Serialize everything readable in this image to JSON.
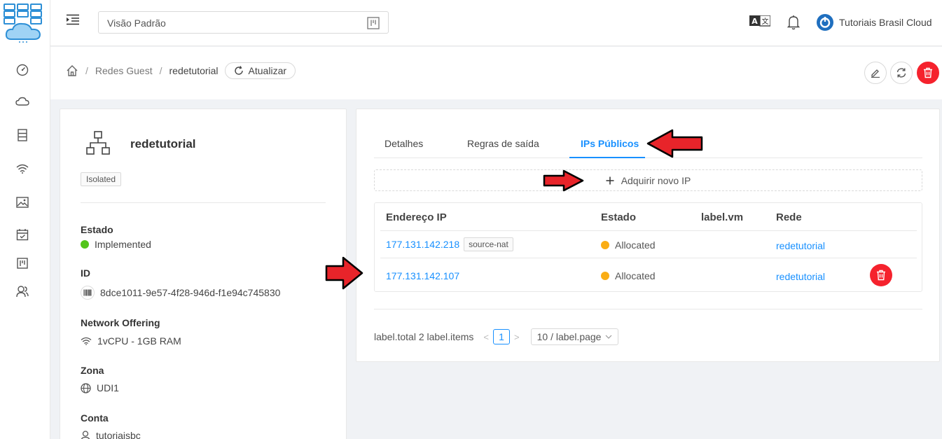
{
  "header": {
    "project_selector": "Visão Padrão",
    "user_name": "Tutoriais Brasil Cloud"
  },
  "breadcrumb": {
    "items": [
      "Redes Guest",
      "redetutorial"
    ],
    "refresh_label": "Atualizar"
  },
  "network": {
    "name": "redetutorial",
    "type_tag": "Isolated",
    "fields": [
      {
        "label": "Estado",
        "value": "Implemented",
        "icon": "green-status-dot"
      },
      {
        "label": "ID",
        "value": "8dce1011-9e57-4f28-946d-f1e94c745830",
        "icon": "barcode-icon"
      },
      {
        "label": "Network Offering",
        "value": "1vCPU - 1GB RAM",
        "icon": "wifi-icon"
      },
      {
        "label": "Zona",
        "value": "UDI1",
        "icon": "globe-icon"
      },
      {
        "label": "Conta",
        "value": "tutoriaisbc",
        "icon": "user-icon"
      }
    ]
  },
  "tabs": [
    {
      "label": "Detalhes",
      "active": false
    },
    {
      "label": "Regras de saída",
      "active": false
    },
    {
      "label": "IPs Públicos",
      "active": true
    }
  ],
  "add_ip_label": "Adquirir novo IP",
  "ip_table": {
    "columns": [
      "Endereço IP",
      "Estado",
      "label.vm",
      "Rede"
    ],
    "rows": [
      {
        "ip": "177.131.142.218",
        "tag": "source-nat",
        "state": "Allocated",
        "vm": "",
        "network": "redetutorial",
        "deletable": false
      },
      {
        "ip": "177.131.142.107",
        "tag": "",
        "state": "Allocated",
        "vm": "",
        "network": "redetutorial",
        "deletable": true
      }
    ]
  },
  "pagination": {
    "total_text": "label.total 2 label.items",
    "current_page": "1",
    "page_size": "10 / label.page"
  },
  "colors": {
    "primary": "#1890ff",
    "danger": "#f5222d",
    "status_green": "#52c41a",
    "status_orange": "#faad14",
    "arrow_red": "#e8242a"
  }
}
